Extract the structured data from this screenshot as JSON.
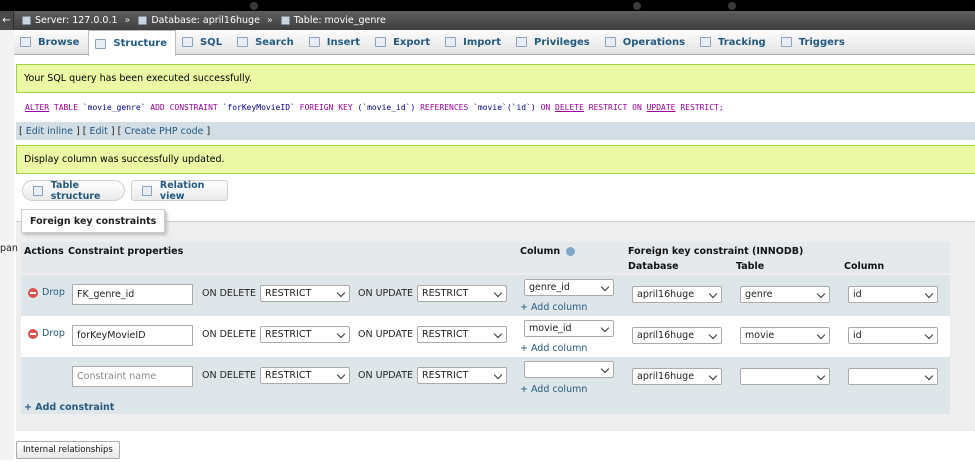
{
  "breadcrumb": {
    "back": "←",
    "server": "Server: 127.0.0.1",
    "database": "Database: april16huge",
    "table": "Table: movie_genre",
    "separator": "»"
  },
  "tabs": [
    {
      "label": "Browse",
      "icon": "browse-icon"
    },
    {
      "label": "Structure",
      "icon": "structure-icon",
      "active": true
    },
    {
      "label": "SQL",
      "icon": "sql-icon"
    },
    {
      "label": "Search",
      "icon": "search-icon"
    },
    {
      "label": "Insert",
      "icon": "insert-icon"
    },
    {
      "label": "Export",
      "icon": "export-icon"
    },
    {
      "label": "Import",
      "icon": "import-icon"
    },
    {
      "label": "Privileges",
      "icon": "privileges-icon"
    },
    {
      "label": "Operations",
      "icon": "operations-icon"
    },
    {
      "label": "Tracking",
      "icon": "tracking-icon"
    },
    {
      "label": "Triggers",
      "icon": "triggers-icon"
    }
  ],
  "messages": {
    "query_success": "Your SQL query has been executed successfully.",
    "display_column": "Display column was successfully updated."
  },
  "sql": {
    "alter": "ALTER",
    "table_kw": "TABLE",
    "table_name": "`movie_genre`",
    "add": "ADD",
    "constraint_kw": "CONSTRAINT",
    "constraint_name": "`forKeyMovieID`",
    "foreign": "FOREIGN",
    "key": "KEY",
    "col": "(`movie_id`)",
    "references": "REFERENCES",
    "ref_table": "`movie`",
    "ref_col": "(`id`)",
    "on1": "ON",
    "delete": "DELETE",
    "restrict1": "RESTRICT",
    "on2": "ON",
    "update": "UPDATE",
    "restrict2": "RESTRICT;"
  },
  "sql_tools": {
    "open": "[",
    "edit_inline": "Edit inline",
    "mid1": "] [",
    "edit": "Edit",
    "mid2": "] [",
    "create_php": "Create PHP code",
    "close": "]"
  },
  "view_buttons": {
    "table_structure": "Table structure",
    "relation_view": "Relation view"
  },
  "fieldset_legend": "Foreign key constraints",
  "left_cut_text": "pan",
  "headers": {
    "actions": "Actions",
    "constraint_properties": "Constraint properties",
    "column": "Column",
    "fk_constraint": "Foreign key constraint (INNODB)",
    "database": "Database",
    "table": "Table",
    "column2": "Column"
  },
  "rows": [
    {
      "drop": "Drop",
      "name": "FK_genre_id",
      "on_delete_label": "ON DELETE",
      "on_delete": "RESTRICT",
      "on_update_label": "ON UPDATE",
      "on_update": "RESTRICT",
      "column": "genre_id",
      "add_column": "+ Add column",
      "database": "april16huge",
      "table": "genre",
      "ref_column": "id"
    },
    {
      "drop": "Drop",
      "name": "forKeyMovieID",
      "on_delete_label": "ON DELETE",
      "on_delete": "RESTRICT",
      "on_update_label": "ON UPDATE",
      "on_update": "RESTRICT",
      "column": "movie_id",
      "add_column": "+ Add column",
      "database": "april16huge",
      "table": "movie",
      "ref_column": "id"
    },
    {
      "drop": "",
      "name_placeholder": "Constraint name",
      "on_delete_label": "ON DELETE",
      "on_delete": "RESTRICT",
      "on_update_label": "ON UPDATE",
      "on_update": "RESTRICT",
      "column": "",
      "add_column": "+ Add column",
      "database": "april16huge",
      "table": "",
      "ref_column": ""
    }
  ],
  "add_constraint": "+ Add constraint",
  "internal_relationships": "Internal relationships",
  "colors": {
    "link": "#235a81",
    "success_bg": "#ebf8a4",
    "success_border": "#a2d246",
    "row_alt": "#dfe6ea",
    "drop_icon": "#d9534f"
  }
}
